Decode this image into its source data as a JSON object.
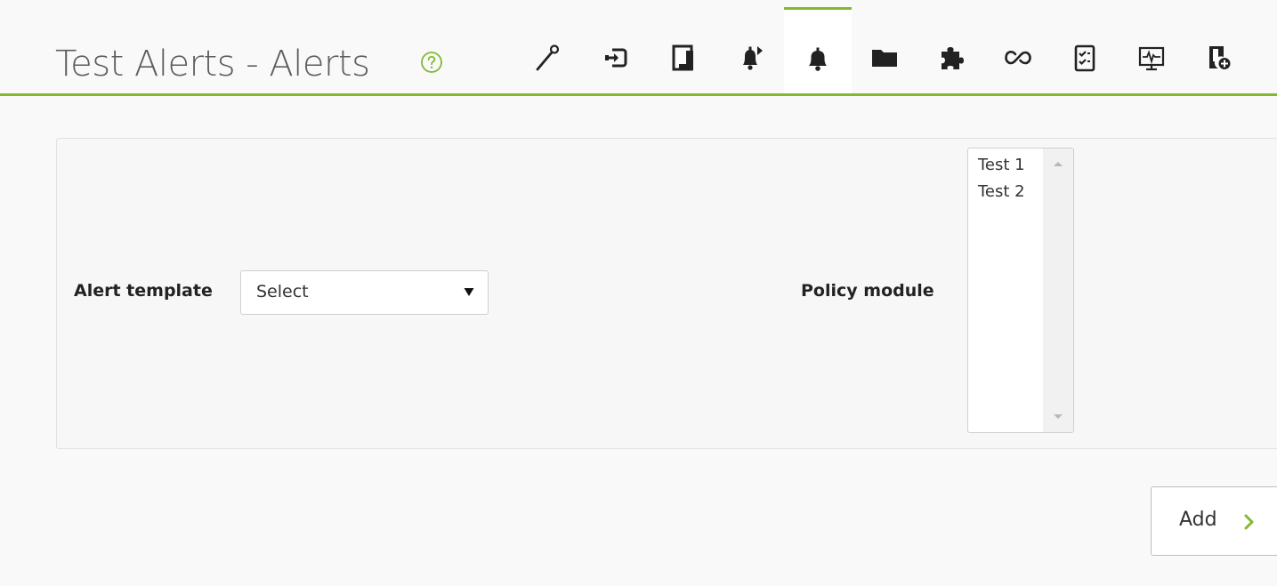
{
  "header": {
    "title": "Test Alerts - Alerts",
    "help_icon": "help-circle-icon"
  },
  "toolbar": {
    "items": [
      {
        "icon": "wand-icon"
      },
      {
        "icon": "login-icon"
      },
      {
        "icon": "copy-icon"
      },
      {
        "icon": "bell-arrow-icon"
      },
      {
        "icon": "bell-icon",
        "active": true
      },
      {
        "icon": "folder-icon"
      },
      {
        "icon": "puzzle-icon"
      },
      {
        "icon": "link-icon"
      },
      {
        "icon": "checklist-icon"
      },
      {
        "icon": "monitor-icon"
      },
      {
        "icon": "add-module-icon"
      }
    ]
  },
  "form": {
    "alert_template_label": "Alert template",
    "alert_template_value": "Select",
    "policy_module_label": "Policy module",
    "policy_module_options": [
      "Test 1",
      "Test 2"
    ]
  },
  "actions": {
    "add_label": "Add"
  },
  "colors": {
    "accent": "#82b92e",
    "icon": "#222222",
    "title": "#5d5d5d"
  }
}
